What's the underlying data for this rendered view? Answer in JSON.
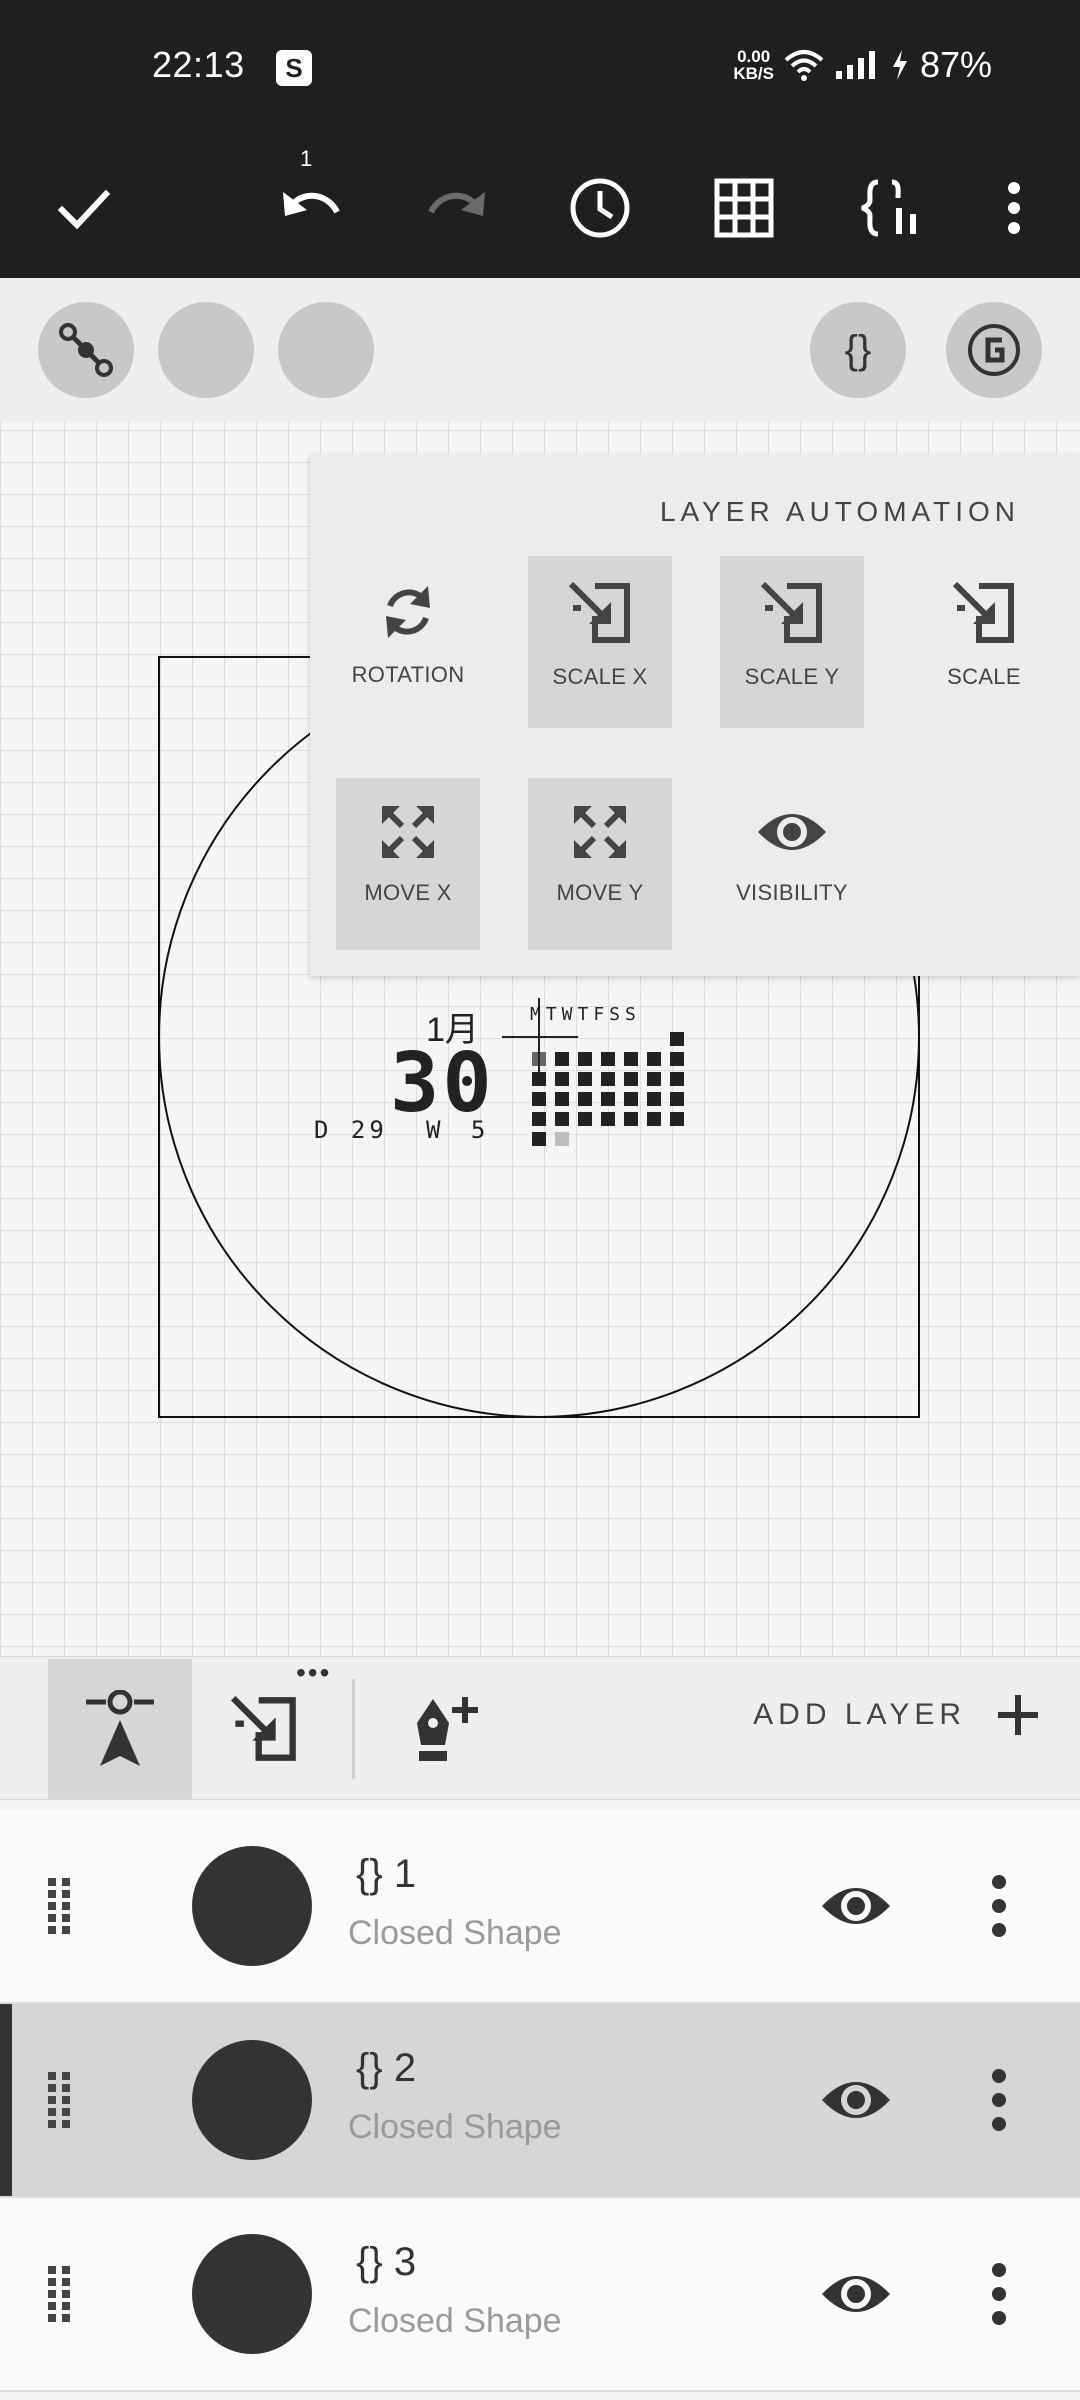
{
  "status_bar": {
    "time": "22:13",
    "app_badge": "S",
    "net_speed_value": "0.00",
    "net_speed_unit": "KB/S",
    "battery": "87%"
  },
  "toolbar": {
    "undo_count": "1",
    "icons": [
      "check-icon",
      "undo-icon",
      "redo-icon",
      "history-icon",
      "grid-icon",
      "code-icon",
      "more-vertical-icon"
    ]
  },
  "subbar": {
    "code_glyph": "{}",
    "global_glyph": "G"
  },
  "watchface": {
    "month": "1月",
    "day": "30",
    "day_of_year": "D 29",
    "week": "W 5",
    "weekdays": "MTWTFSS"
  },
  "automation": {
    "title": "LAYER AUTOMATION",
    "items": [
      {
        "label": "ROTATION",
        "icon": "rotate-icon",
        "selected": false
      },
      {
        "label": "SCALE X",
        "icon": "scale-icon",
        "selected": true
      },
      {
        "label": "SCALE Y",
        "icon": "scale-icon",
        "selected": true
      },
      {
        "label": "SCALE",
        "icon": "scale-icon",
        "selected": false
      },
      {
        "label": "MOVE X",
        "icon": "expand-icon",
        "selected": true
      },
      {
        "label": "MOVE Y",
        "icon": "expand-icon",
        "selected": true
      },
      {
        "label": "VISIBILITY",
        "icon": "eye-icon",
        "selected": false
      }
    ]
  },
  "layer_toolbar": {
    "more_dots": "•••",
    "add_layer_label": "ADD LAYER"
  },
  "layers": [
    {
      "name": "{} 1",
      "type": "Closed Shape",
      "selected": false
    },
    {
      "name": "{} 2",
      "type": "Closed Shape",
      "selected": true
    },
    {
      "name": "{} 3",
      "type": "Closed Shape",
      "selected": false
    }
  ],
  "colors": {
    "dark_bar": "#1f1f1f",
    "selected_bg": "#d6d6d6",
    "popup_bg": "#ececec",
    "thumb": "#333333"
  }
}
